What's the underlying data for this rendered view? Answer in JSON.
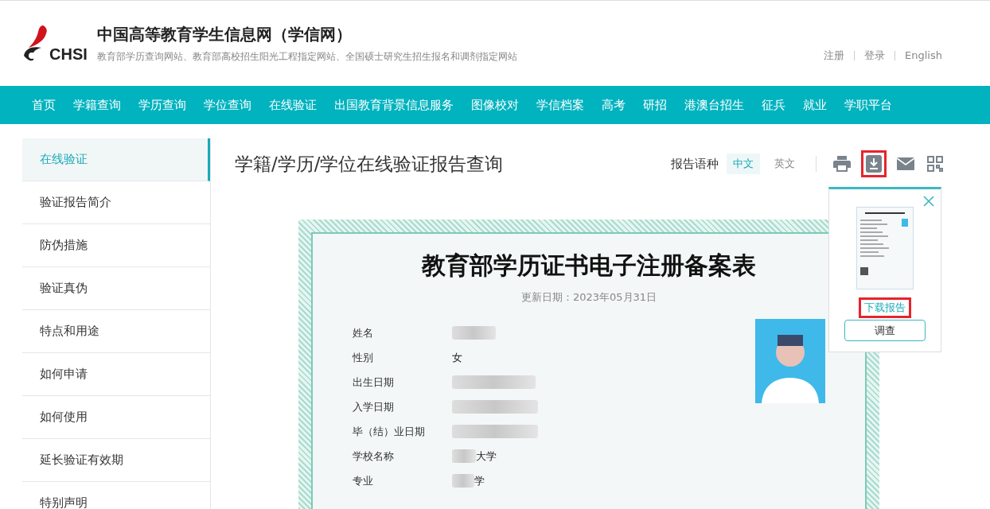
{
  "header": {
    "logo_text": "CHSI",
    "title": "中国高等教育学生信息网（学信网）",
    "subtitle": "教育部学历查询网站、教育部高校招生阳光工程指定网站、全国硕士研究生招生报名和调剂指定网站",
    "links": [
      "注册",
      "登录",
      "English"
    ]
  },
  "nav": [
    "首页",
    "学籍查询",
    "学历查询",
    "学位查询",
    "在线验证",
    "出国教育背景信息服务",
    "图像校对",
    "学信档案",
    "高考",
    "研招",
    "港澳台招生",
    "征兵",
    "就业",
    "学职平台"
  ],
  "sidebar": [
    {
      "label": "在线验证",
      "selected": true
    },
    {
      "label": "验证报告简介",
      "selected": false
    },
    {
      "label": "防伪措施",
      "selected": false
    },
    {
      "label": "验证真伪",
      "selected": false
    },
    {
      "label": "特点和用途",
      "selected": false
    },
    {
      "label": "如何申请",
      "selected": false
    },
    {
      "label": "如何使用",
      "selected": false
    },
    {
      "label": "延长验证有效期",
      "selected": false
    },
    {
      "label": "特别声明",
      "selected": false
    }
  ],
  "page_title": "学籍/学历/学位在线验证报告查询",
  "language": {
    "label": "报告语种",
    "options": [
      {
        "label": "中文",
        "selected": true
      },
      {
        "label": "英文",
        "selected": false
      }
    ]
  },
  "toolbar": [
    {
      "kind": "print",
      "highlighted": false
    },
    {
      "kind": "download",
      "highlighted": true
    },
    {
      "kind": "mail",
      "highlighted": false
    },
    {
      "kind": "qr",
      "highlighted": false
    }
  ],
  "popup": {
    "link": "下载报告",
    "link_highlighted": true,
    "button": "调查"
  },
  "report": {
    "title": "教育部学历证书电子注册备案表",
    "updated": "更新日期：2023年05月31日",
    "fields": [
      {
        "label": "姓名",
        "blurred": true
      },
      {
        "label": "性别",
        "value_suffix": "女",
        "blurred": false
      },
      {
        "label": "出生日期",
        "blurred": true
      },
      {
        "label": "入学日期",
        "blurred": true
      },
      {
        "label": "毕（结）业日期",
        "blurred": true
      },
      {
        "label": "学校名称",
        "value_suffix": "大学",
        "blurred": true
      },
      {
        "label": "专业",
        "value_suffix": "学",
        "blurred": true
      }
    ]
  }
}
